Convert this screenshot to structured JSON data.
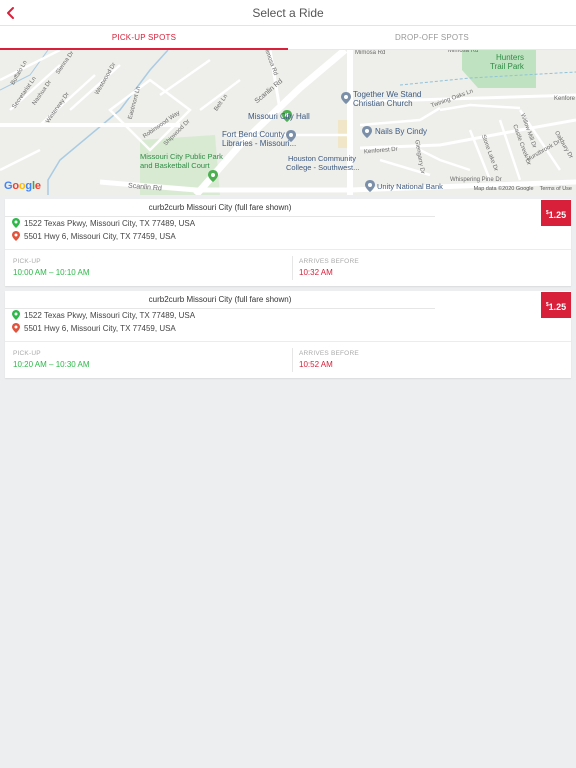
{
  "header": {
    "title": "Select a Ride",
    "back_icon": "chevron-left-icon"
  },
  "tabs": [
    {
      "label": "PICK-UP SPOTS",
      "active": true
    },
    {
      "label": "DROP-OFF SPOTS",
      "active": false
    }
  ],
  "map": {
    "logo": "Google",
    "attribution": "Map data ©2020 Google",
    "terms": "Terms of Use",
    "labels": {
      "poi_hall": "Missouri City Hall",
      "poi_library_1": "Fort Bend County",
      "poi_library_2": "Libraries - Missouri...",
      "poi_park_1": "Missouri City Public Park",
      "poi_park_2": "and Basketball Court",
      "poi_church_1": "Together We Stand",
      "poi_church_2": "Christian Church",
      "poi_nails": "Nails By Cindy",
      "poi_college_1": "Houston Community",
      "poi_college_2": "College - Southwest...",
      "poi_bank": "Unity National Bank",
      "poi_trail_1": "Hunters",
      "poi_trail_2": "Trail Park",
      "street_scanlin": "Scanlin Rd",
      "street_scanlin2": "Scanlin Rd",
      "street_mimosa": "Mimosa Rd",
      "street_mimosa2": "Mimosa Rd",
      "street_kenforest": "Kenforest Dr",
      "street_kenfore2": "Kenfore",
      "street_twining": "Twining Oaks Ln",
      "street_whispering": "Whispering Pine Dr",
      "street_hurstbrook": "Hurstbrook Dr",
      "street_glengarry": "Glengarry Dr",
      "street_stone": "Stone Lake Dr",
      "street_castle": "Castle Creek Dr",
      "street_willow": "Willow Mill Dr",
      "street_oakbury": "Oakbury Dr",
      "street_belt": "Belt Ln",
      "street_eastmont": "Eastmont Ln",
      "street_robinwood": "Robinwood Way",
      "street_shipwood": "Shipwood Dr",
      "street_westwood": "Westwood Dr",
      "street_nashua": "Nashua Dr",
      "street_winterway": "Winterway Dr",
      "street_secretariat": "Secretariat Ln",
      "street_buffalo": "Buffalo Ln",
      "street_sienna": "Sienna Dr"
    }
  },
  "rides": [
    {
      "provider": "curb2curb Missouri City (full fare shown)",
      "price_symbol": "$",
      "price": "1.25",
      "pickup_address": "1522 Texas Pkwy, Missouri City, TX 77489, USA",
      "dropoff_address": "5501 Hwy 6, Missouri City, TX 77459, USA",
      "pickup_label": "PICK-UP",
      "pickup_window": "10:00 AM – 10:10 AM",
      "arrive_label": "ARRIVES BEFORE",
      "arrive_time": "10:32 AM"
    },
    {
      "provider": "curb2curb Missouri City (full fare shown)",
      "price_symbol": "$",
      "price": "1.25",
      "pickup_address": "1522 Texas Pkwy, Missouri City, TX 77489, USA",
      "dropoff_address": "5501 Hwy 6, Missouri City, TX 77459, USA",
      "pickup_label": "PICK-UP",
      "pickup_window": "10:20 AM – 10:30 AM",
      "arrive_label": "ARRIVES BEFORE",
      "arrive_time": "10:52 AM"
    }
  ],
  "colors": {
    "accent": "#d8203a",
    "pickup_green": "#2eb84a",
    "dropoff_red": "#e0533c",
    "background": "#eceef0",
    "map_water": "#a9cce3",
    "map_park": "#bfe3c0"
  }
}
